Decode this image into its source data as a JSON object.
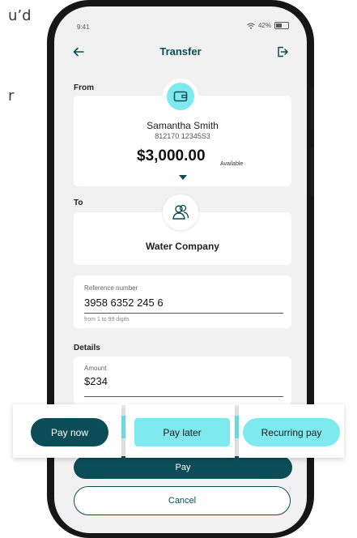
{
  "background": {
    "text_1": "u’d",
    "text_2": "r"
  },
  "status_bar": {
    "time": "9:41",
    "battery": "42%"
  },
  "header": {
    "title": "Transfer"
  },
  "from": {
    "label": "From",
    "name": "Samantha Smith",
    "account": "812170  12345S3",
    "balance": "$3,000.00",
    "available_label": "Available"
  },
  "to": {
    "label": "To",
    "payee": "Water Company"
  },
  "reference": {
    "label": "Reference number",
    "value": "3958 6352 245 6",
    "hint": "from 1 to 99 digits"
  },
  "details": {
    "label": "Details",
    "amount_label": "Amount",
    "amount_value": "$234"
  },
  "buttons": {
    "pay": "Pay",
    "cancel": "Cancel"
  },
  "payment_options": {
    "pay_now": "Pay now",
    "pay_later": "Pay later",
    "recurring_pay": "Recurring pay"
  },
  "colors": {
    "primary": "#0b4d56",
    "accent": "#7ee9ef",
    "screen_bg": "#f1f1f1"
  }
}
